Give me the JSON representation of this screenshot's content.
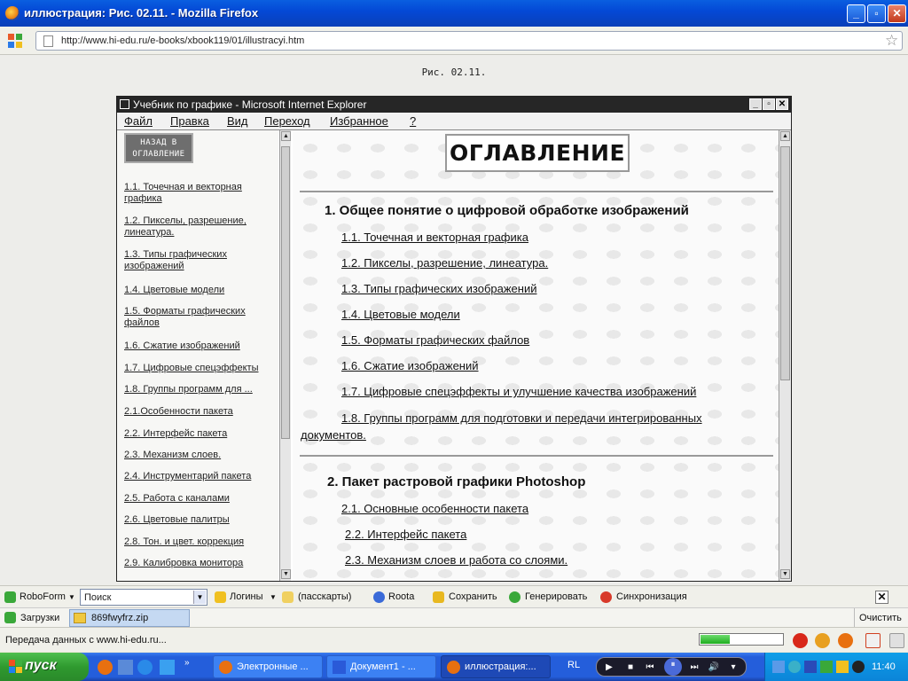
{
  "window": {
    "title": "иллюстрация: Рис. 02.11. - Mozilla Firefox",
    "controls": [
      "_",
      "▫",
      "✕"
    ]
  },
  "navbar": {
    "url": "http://www.hi-edu.ru/e-books/xbook119/01/illustracyi.htm"
  },
  "page": {
    "caption": "Рис. 02.11."
  },
  "ie": {
    "title": "Учебник по графике - Microsoft Internet Explorer",
    "menu": [
      "Файл",
      "Правка",
      "Вид",
      "Переход",
      "Избранное",
      "?"
    ],
    "back_button_line1": "НАЗАД В",
    "back_button_line2": "ОГЛАВЛЕНИЕ",
    "left_links": [
      "1.1. Точечная и векторная графика",
      "1.2. Пикселы, разрешение, линеатура.",
      "1.3. Типы графических изображений",
      "1.4. Цветовые модели",
      "1.5. Форматы графических файлов",
      "1.6. Сжатие изображений",
      "1.7. Цифровые спецэффекты",
      "1.8. Группы программ для ...",
      "2.1.Особенности пакета",
      "2.2. Интерфейс пакета",
      "2.3. Механизм слоев.",
      "2.4. Инструментарий пакета",
      "2.5. Работа с каналами",
      "2.6. Цветовые палитры",
      "2.8. Тон. и цвет. коррекция",
      "2.9. Калибровка монитора"
    ],
    "toc_title": "ОГЛАВЛЕНИЕ",
    "section1": {
      "title": "1. Общее понятие о цифровой обработке изображений",
      "items": [
        "1.1. Точечная и векторная графика",
        "1.2. Пикселы, разрешение, линеатура.",
        "1.3. Типы графических изображений",
        "1.4. Цветовые модели",
        "1.5. Форматы графических файлов",
        "1.6. Сжатие изображений",
        "1.7. Цифровые спецэффекты и улучшение качества изображений",
        "1.8. Группы программ для подготовки и передачи интегрированных",
        "документов."
      ]
    },
    "section2": {
      "title": "2. Пакет растровой графики Photoshop",
      "items": [
        "2.1. Основные особенности пакета",
        "2.2. Интерфейс пакета",
        "2.3. Механизм слоев и работа со слоями."
      ]
    }
  },
  "roboform": {
    "brand": "RoboForm",
    "search_placeholder": "Поиск",
    "logins": "Логины",
    "passcards": "(пасскарты)",
    "roota": "Roota",
    "save": "Сохранить",
    "generate": "Генерировать",
    "sync": "Синхронизация"
  },
  "downloads": {
    "label": "Загрузки",
    "file": "869fwyfrz.zip",
    "clear": "Очистить"
  },
  "status": {
    "text": "Передача данных с www.hi-edu.ru...",
    "progress": 0.35
  },
  "taskbar": {
    "start": "пуск",
    "tasks": [
      "Электронные ...",
      "Документ1 - ...",
      "иллюстрация:..."
    ],
    "lang": "RL",
    "clock": "11:40"
  }
}
